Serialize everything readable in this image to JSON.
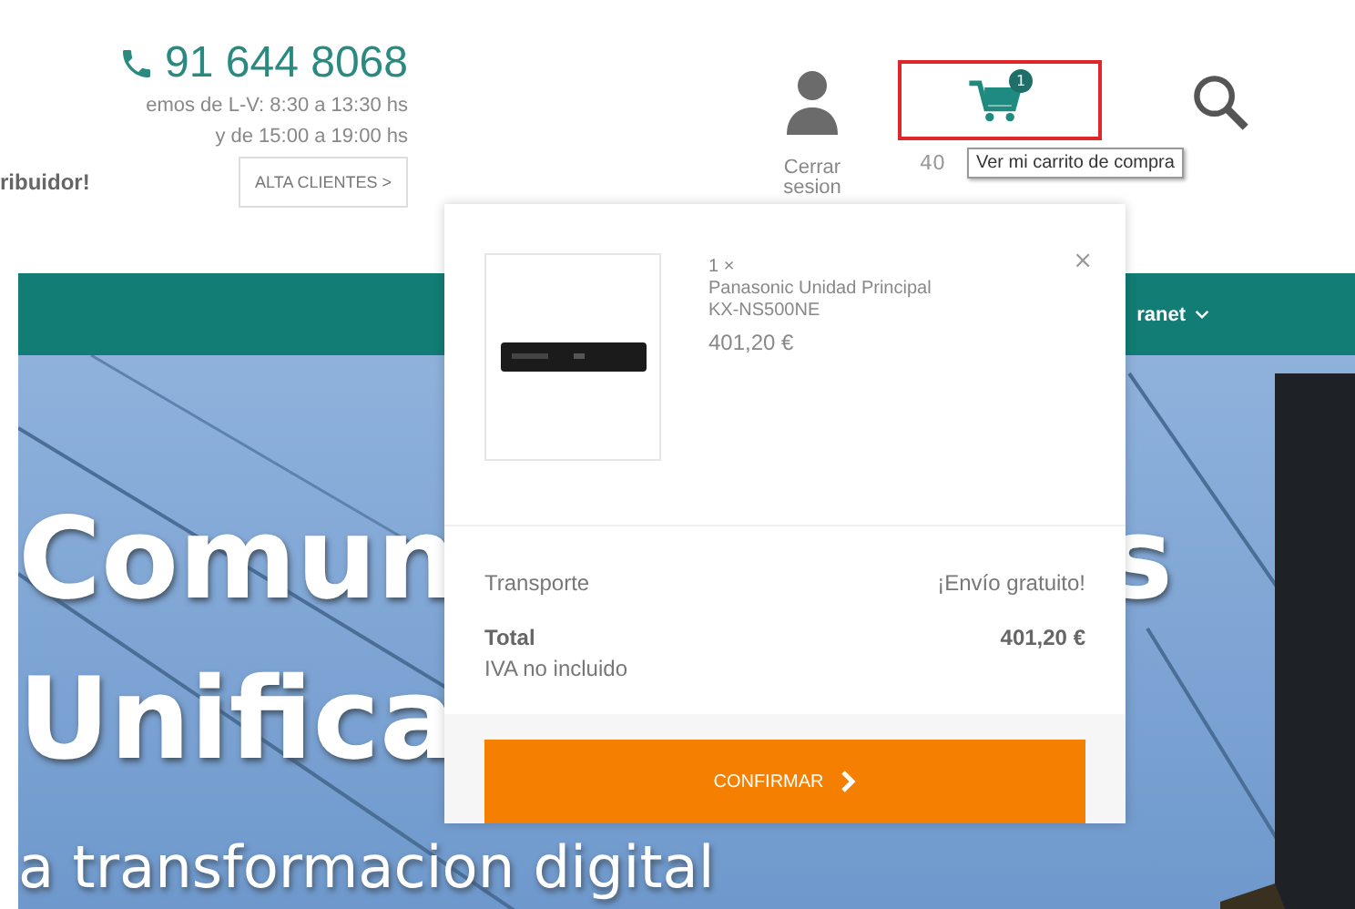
{
  "header": {
    "phone": "91 644 8068",
    "hours": [
      "emos de L-V: 8:30 a 13:30 hs",
      "y de 15:00 a 19:00 hs"
    ],
    "promo": "ribuidor!",
    "signup_button": "ALTA CLIENTES >",
    "account": {
      "label": "Cerrar sesion"
    },
    "cart": {
      "count": "1",
      "amount": "40",
      "tooltip": "Ver mi carrito de compra",
      "highlighted": true
    }
  },
  "nav": {
    "items": [
      {
        "label": "ranet"
      }
    ]
  },
  "hero": {
    "lines": [
      {
        "left": "Comun",
        "right": "s"
      },
      {
        "left": "Unifica"
      },
      {
        "left": "a transformacion digital"
      }
    ]
  },
  "cart_popup": {
    "items": [
      {
        "quantity": "1 ×",
        "name": "Panasonic Unidad Principal",
        "model": "KX-NS500NE",
        "price": "401,20 €"
      }
    ],
    "close": "×",
    "shipping": {
      "label": "Transporte",
      "value": "¡Envío gratuito!"
    },
    "total": {
      "label": "Total",
      "value": "401,20 €"
    },
    "tax_note": "IVA no incluido",
    "confirm_button": "CONFIRMAR"
  }
}
